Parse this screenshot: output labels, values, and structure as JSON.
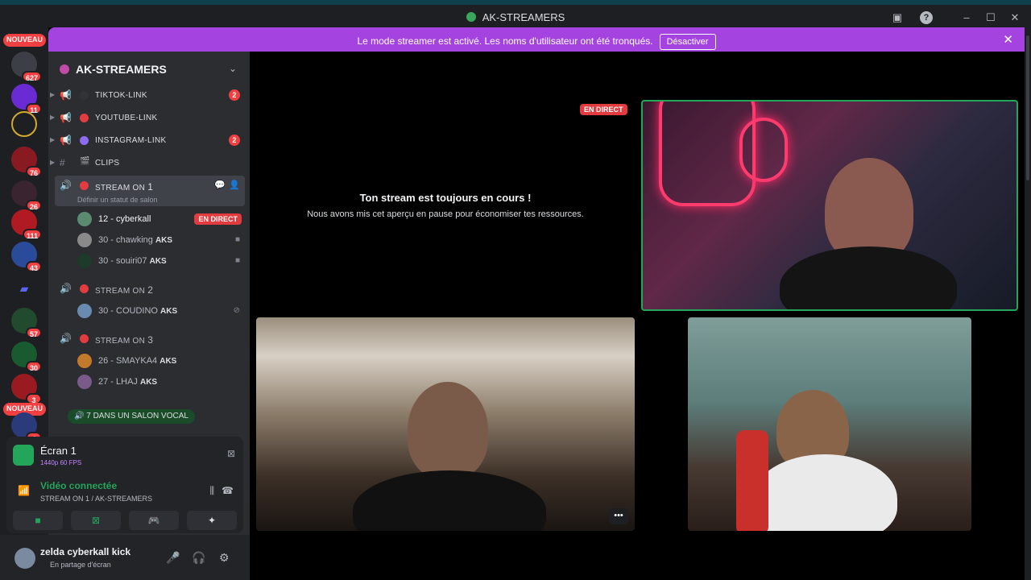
{
  "window": {
    "title": "AK-STREAMERS"
  },
  "banner": {
    "text": "Le mode streamer est activé. Les noms d'utilisateur ont été tronqués.",
    "button": "Désactiver"
  },
  "guilds": {
    "badges": [
      "NOUVEAU",
      "627",
      "11",
      "76",
      "26",
      "111",
      "43",
      "57",
      "30",
      "3",
      "NOUVEAU",
      "4"
    ]
  },
  "server": {
    "name": "AK-STREAMERS"
  },
  "channels": [
    {
      "name": "TIKTOK-LINK",
      "badge": "2",
      "color": "#313338"
    },
    {
      "name": "YOUTUBE-LINK",
      "badge": "",
      "color": "#e23c41"
    },
    {
      "name": "INSTAGRAM-LINK",
      "badge": "2",
      "color": "#8c6cf0"
    },
    {
      "name": "CLIPS",
      "badge": ""
    }
  ],
  "voice": [
    {
      "name": "STREAM ON ",
      "num": "1",
      "status": "Définir un statut de salon",
      "members": [
        {
          "name": "12 - cyberkall",
          "live": "EN DIRECT"
        },
        {
          "name": "30 - chawking",
          "tag": "AKS"
        },
        {
          "name": "30 - souiri07",
          "tag": "AKS"
        }
      ]
    },
    {
      "name": "STREAM ON ",
      "num": "2",
      "members": [
        {
          "name": "30 - COUDINO",
          "tag": "AKS"
        }
      ]
    },
    {
      "name": "STREAM ON ",
      "num": "3",
      "members": [
        {
          "name": "26 - SMAYKA4",
          "tag": "AKS"
        },
        {
          "name": "27 - LHAJ",
          "tag": "AKS"
        }
      ]
    }
  ],
  "voice_pill": "7 DANS UN SALON VOCAL",
  "panel": {
    "screen_title": "Écran 1",
    "screen_sub": "1440p 60 FPS",
    "video_connected": "Vidéo connectée",
    "video_channel": "STREAM ON 1 / AK-STREAMERS"
  },
  "user": {
    "name": "zelda cyberkall kick",
    "status": "En partage d'écran"
  },
  "stage": {
    "paused_title": "Ton stream est toujours en cours !",
    "paused_sub": "Nous avons mis cet aperçu en pause pour économiser tes ressources.",
    "live": "EN DIRECT"
  },
  "colors": {
    "brand": "#5865f2",
    "green": "#23a55a",
    "red": "#e23c41",
    "banner": "#a443e0"
  }
}
